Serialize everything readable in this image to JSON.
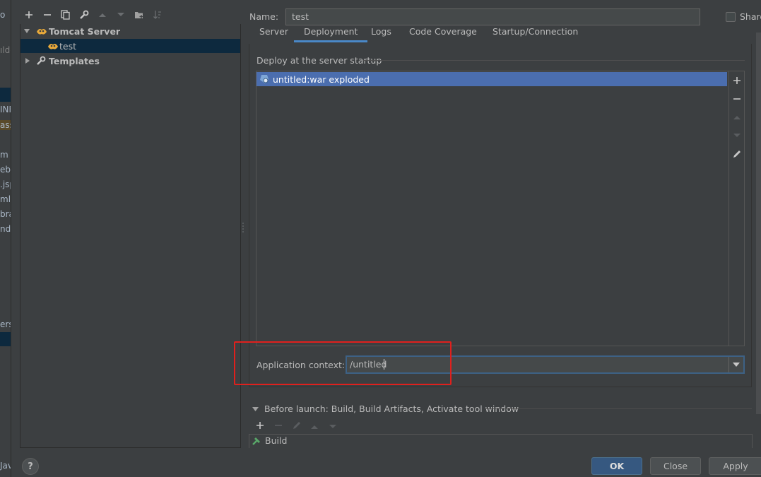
{
  "bg_strip": {
    "items": [
      "o",
      "ılde",
      "INF",
      "asse",
      "m",
      "eb.x",
      ".jsp",
      "ml",
      "brar",
      "nd",
      "ers",
      "Jav"
    ]
  },
  "left_toolbar": {
    "icons": [
      "add-icon",
      "remove-icon",
      "copy-icon",
      "wrench-icon",
      "move-up-icon",
      "move-down-icon",
      "new-folder-icon",
      "sort-icon"
    ]
  },
  "tree": {
    "tomcat_server": "Tomcat Server",
    "test": "test",
    "templates": "Templates"
  },
  "name_label": "Name:",
  "name_value": "test",
  "share_label": "Share",
  "tabs": [
    {
      "label": "Server"
    },
    {
      "label": "Deployment"
    },
    {
      "label": "Logs"
    },
    {
      "label": "Code Coverage"
    },
    {
      "label": "Startup/Connection"
    }
  ],
  "deploy": {
    "title": "Deploy at the server startup",
    "item": "untitled:war exploded"
  },
  "app_context": {
    "label": "Application context:",
    "value": "/untitled"
  },
  "before_launch": {
    "label": "Before launch: Build, Build Artifacts, Activate tool window",
    "item": "Build"
  },
  "buttons": {
    "ok": "OK",
    "close": "Close",
    "apply": "Apply",
    "help": "?"
  },
  "colors": {
    "accent": "#4a88c7",
    "selection": "#4b6eaf",
    "highlight": "#e0201d"
  }
}
